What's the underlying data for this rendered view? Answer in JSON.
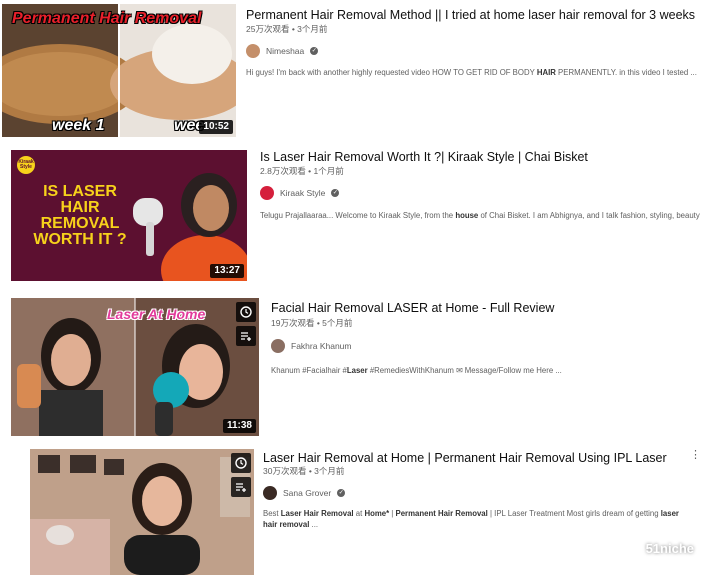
{
  "results": [
    {
      "title": "Permanent Hair Removal Method || I tried at home laser hair removal for 3 weeks",
      "meta": "25万次观看 • 3个月前",
      "channel": "Nimeshaa",
      "description_parts": [
        "Hi guys! I'm back with another highly requested video HOW TO GET RID OF BODY ",
        "HAIR",
        " PERMANENTLY. in this video I tested ..."
      ],
      "duration": "10:52",
      "thumb_text": {
        "banner": "Permanent Hair Removal",
        "left": "week 1",
        "right": "wee"
      }
    },
    {
      "title": "Is Laser Hair Removal Worth It ?| Kiraak Style | Chai Bisket",
      "meta": "2.8万次观看 • 1个月前",
      "channel": "Kiraak Style",
      "description_parts": [
        "Telugu Prajallaaraa... Welcome to Kiraak Style, from the ",
        "house",
        " of Chai Bisket. I am Abhignya, and I talk fashion, styling, beauty"
      ],
      "duration": "13:27",
      "thumb_text": {
        "headline": "IS LASER HAIR REMOVAL WORTH IT ?",
        "logo": "Kiraak Style"
      }
    },
    {
      "title": "Facial Hair Removal LASER at Home - Full Review",
      "meta": "19万次观看 • 5个月前",
      "channel": "Fakhra Khanum",
      "description_parts": [
        "Khanum #Facialhair #",
        "Laser",
        " #RemediesWithKhanum ✉ Message/Follow me Here  ..."
      ],
      "duration": "11:38",
      "thumb_text": {
        "banner": "Laser At Home"
      }
    },
    {
      "title": "Laser Hair Removal at Home | Permanent Hair Removal Using IPL Laser",
      "meta": "30万次观看 • 3个月前",
      "channel": "Sana Grover",
      "description_parts": [
        "Best ",
        "Laser Hair Removal",
        " at ",
        "Home*",
        " | ",
        "Permanent Hair Removal",
        " | IPL Laser Treatment Most girls dream of getting ",
        "laser hair removal",
        " ..."
      ],
      "duration": ""
    }
  ],
  "watermark": "51niche",
  "icons": {
    "watch_later": "clock-icon",
    "add_to_queue": "queue-icon",
    "more": "kebab-icon",
    "verified": "check-icon"
  },
  "colors": {
    "title": "#0f0f0f",
    "meta": "#606060",
    "banner_red": "#e8202a",
    "laser_pink": "#e23b9b",
    "kiraak_bg": "#5c1030",
    "kiraak_yellow": "#f7d21b"
  }
}
